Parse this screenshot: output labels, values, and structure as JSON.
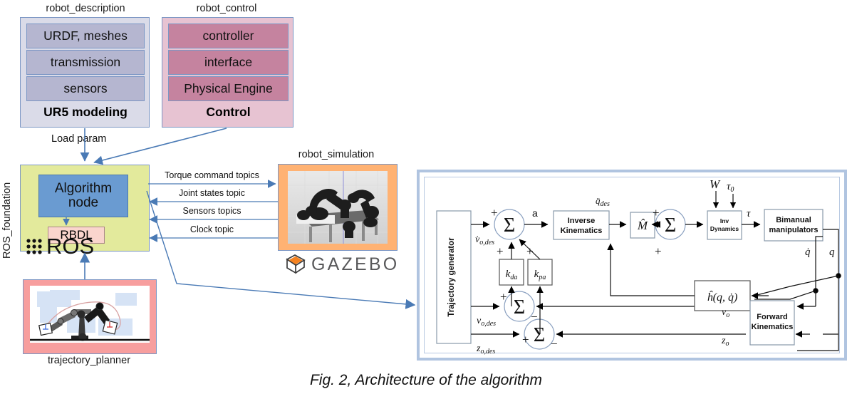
{
  "figure": {
    "caption": "Fig. 2, Architecture of the algorithm"
  },
  "packages": {
    "robot_description": {
      "title": "robot_description",
      "items": [
        "URDF, meshes",
        "transmission",
        "sensors"
      ],
      "footer": "UR5 modeling",
      "color": "#dadbe8",
      "item_color": "#b5b6d0"
    },
    "robot_control": {
      "title": "robot_control",
      "items": [
        "controller",
        "interface",
        "Physical Engine"
      ],
      "footer": "Control",
      "color": "#e7c3d2",
      "item_color": "#c5839f"
    },
    "ros_foundation": {
      "side_label": "ROS_foundation",
      "node_label_line1": "Algorithm",
      "node_label_line2": "node",
      "rbdl_label": "RBDL",
      "ros_label": "ROS",
      "color": "#e3ea9c",
      "node_color": "#6a9bd1",
      "rbdl_color": "#fad5cd"
    },
    "robot_simulation": {
      "title": "robot_simulation",
      "logo_text": "GAZEBO",
      "color": "#ffb273",
      "logo_accent": "#f58220"
    },
    "trajectory_planner": {
      "title": "trajectory_planner",
      "color": "#f79e9e"
    }
  },
  "edges": {
    "load_param": "Load  param",
    "topics": [
      "Torque command topics",
      "Joint states topic",
      "Sensors topics",
      "Clock topic"
    ]
  },
  "control_diagram": {
    "blocks": {
      "trajectory_generator": "Trajectory generator",
      "inverse_kinematics_line1": "Inverse",
      "inverse_kinematics_line2": "Kinematics",
      "mass_matrix": "M̂",
      "inv_dynamics_line1": "Inv",
      "inv_dynamics_line2": "Dynamics",
      "bimanual_line1": "Bimanual",
      "bimanual_line2": "manipulators",
      "h_hat": "ĥ(q, q̇)",
      "forward_kinematics_line1": "Forward",
      "forward_kinematics_line2": "Kinematics",
      "k_da": "k",
      "k_da_sub": "da",
      "k_pa": "k",
      "k_pa_sub": "pa"
    },
    "signals": {
      "v_dot_o_des": "v̇o,des",
      "v_o_des": "vo,des",
      "z_o_des": "zo,des",
      "a": "a",
      "q_ddot_des": "q̈des",
      "W": "W",
      "tau_0": "τ0",
      "tau": "τ",
      "q_dot": "q̇",
      "q": "q",
      "v_o": "vo",
      "z_o": "zo",
      "sum": "Σ",
      "plus": "+",
      "minus": "−"
    }
  },
  "colors": {
    "line_blue": "#4a7ab5",
    "frame_blue": "#b0c4e0",
    "border_blue": "#7b96c4"
  }
}
